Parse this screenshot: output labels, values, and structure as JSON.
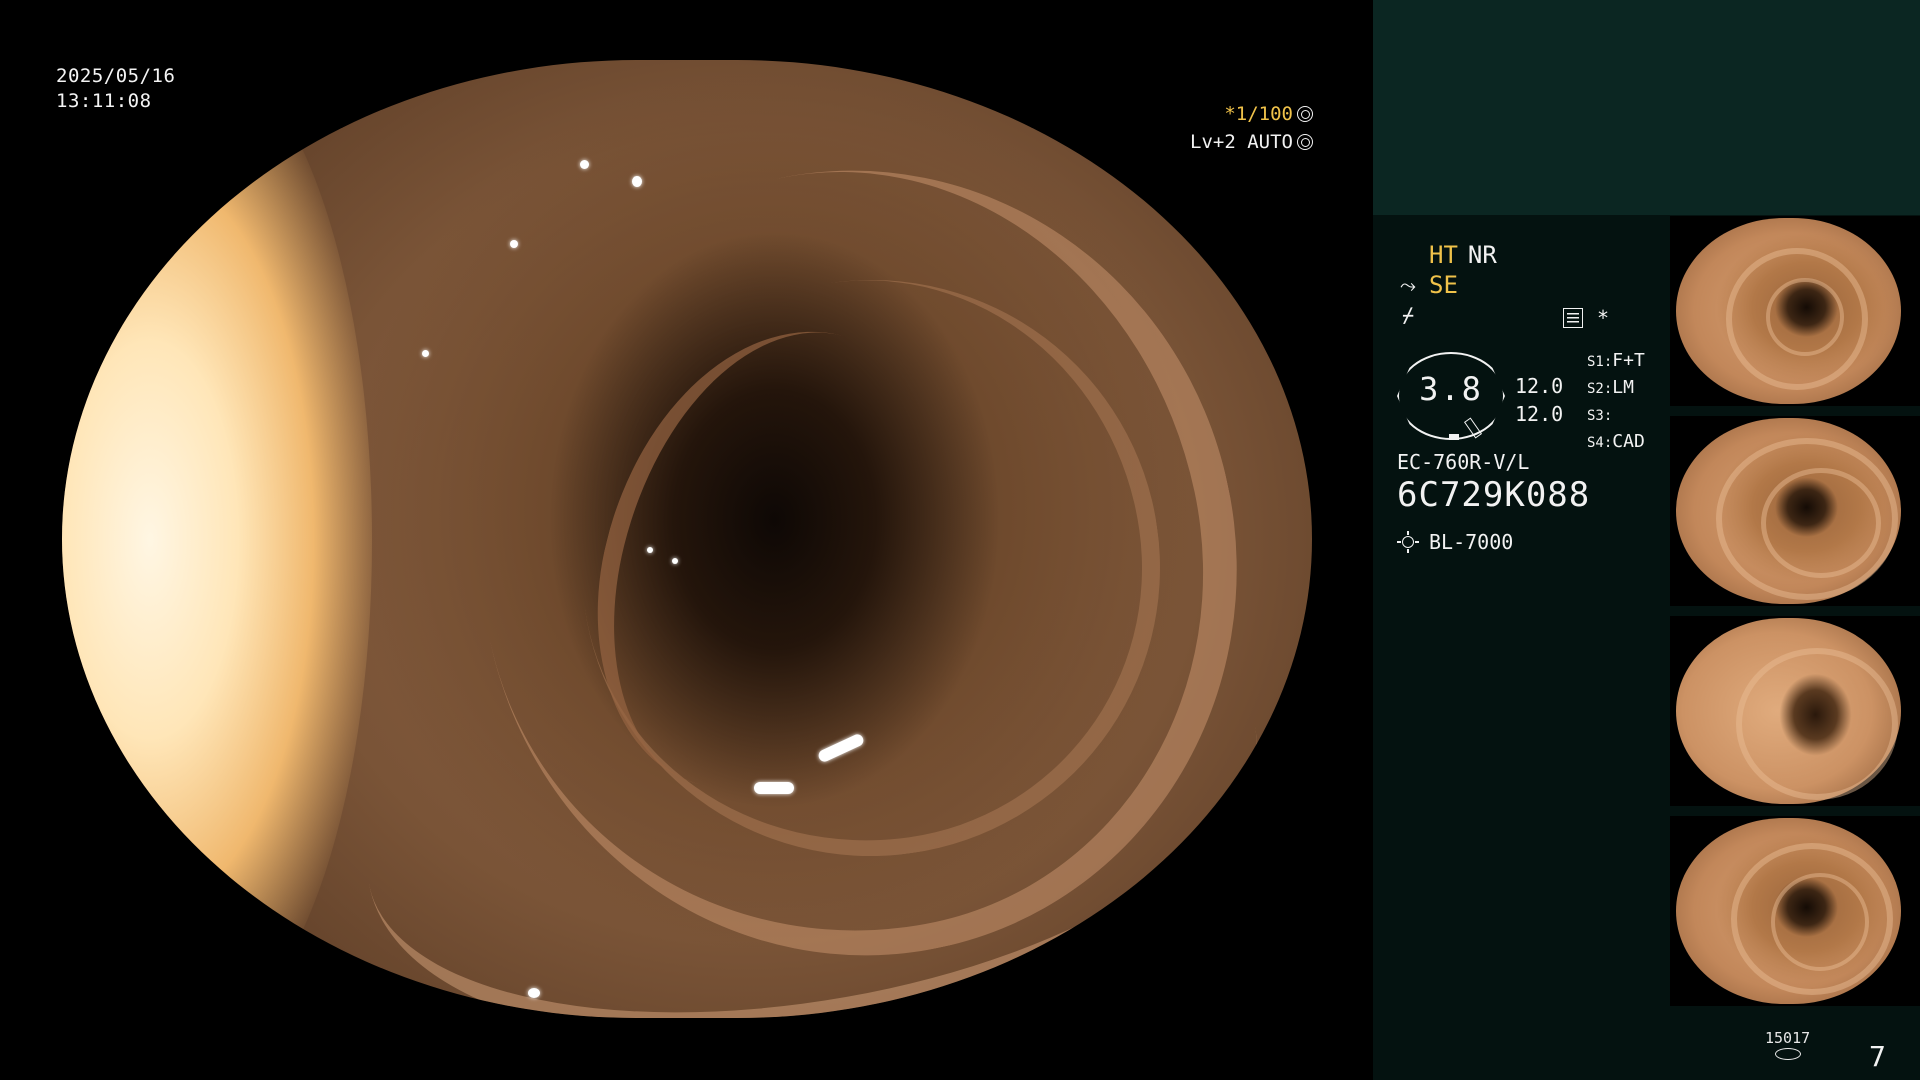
{
  "main_view": {
    "date": "2025/05/16",
    "time": "13:11:08",
    "shutter": "*1/100",
    "mode": "Lv+2 AUTO"
  },
  "panel": {
    "image_modes": {
      "ht": "HT",
      "nr": "NR",
      "se": "SE",
      "freeze_icon": "freeze-icon",
      "grid_icon": "grid-icon",
      "star": "*"
    },
    "gauge": {
      "value": "3.8",
      "values": [
        "12.0",
        "12.0"
      ]
    },
    "switches": [
      {
        "key": "S1:",
        "value": "F+T"
      },
      {
        "key": "S2:",
        "value": "LM"
      },
      {
        "key": "S3:",
        "value": ""
      },
      {
        "key": "S4:",
        "value": "CAD"
      }
    ],
    "scope_model": "EC-760R-V/L",
    "serial": "6C729K088",
    "light_source": "BL-7000",
    "counter_small": "15017",
    "counter_big": "7"
  },
  "colors": {
    "accent_yellow": "#f0c24a",
    "panel_bg": "#041210",
    "panel_top_bg": "#0b2622"
  },
  "thumbnails": [
    {
      "name": "thumbnail-1"
    },
    {
      "name": "thumbnail-2"
    },
    {
      "name": "thumbnail-3"
    },
    {
      "name": "thumbnail-4"
    }
  ]
}
